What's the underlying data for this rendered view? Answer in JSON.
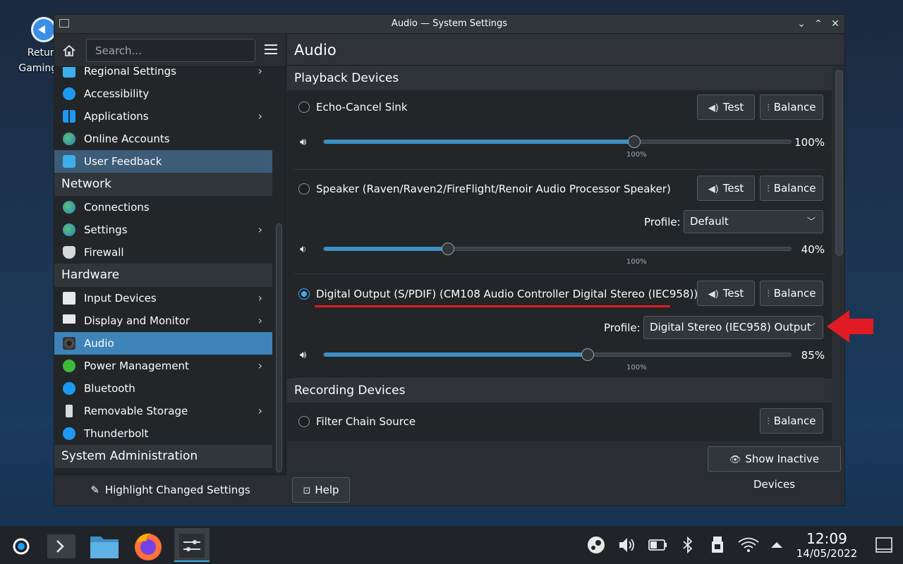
{
  "desktop": {
    "icon_label": "Return to Gaming Mode",
    "icon_label_visible": "Return\nGaming M"
  },
  "window": {
    "title": "Audio — System Settings"
  },
  "sidebar": {
    "search_placeholder": "Search...",
    "items": [
      {
        "label": "Regional Settings",
        "chevron": true,
        "color": "#3daee9"
      },
      {
        "label": "Accessibility",
        "chevron": false,
        "color": "#1d99f3"
      },
      {
        "label": "Applications",
        "chevron": true,
        "color": "#1d99f3"
      },
      {
        "label": "Online Accounts",
        "chevron": false,
        "color": "#27ae60"
      },
      {
        "label": "User Feedback",
        "chevron": false,
        "color": "#3daee9"
      }
    ],
    "network": {
      "category": "Network",
      "items": [
        {
          "label": "Connections",
          "chevron": false
        },
        {
          "label": "Settings",
          "chevron": true
        },
        {
          "label": "Firewall",
          "chevron": false
        }
      ]
    },
    "hardware": {
      "category": "Hardware",
      "items": [
        {
          "label": "Input Devices",
          "chevron": true
        },
        {
          "label": "Display and Monitor",
          "chevron": true
        },
        {
          "label": "Audio",
          "chevron": false
        },
        {
          "label": "Power Management",
          "chevron": true
        },
        {
          "label": "Bluetooth",
          "chevron": false
        },
        {
          "label": "Removable Storage",
          "chevron": true
        },
        {
          "label": "Thunderbolt",
          "chevron": false
        }
      ]
    },
    "system_admin": {
      "category": "System Administration"
    },
    "highlight_changed": "Highlight Changed Settings"
  },
  "main": {
    "title": "Audio",
    "playback_title": "Playback Devices",
    "recording_title": "Recording Devices",
    "test_label": "Test",
    "balance_label": "Balance",
    "profile_label": "Profile:",
    "tick_100": "100%",
    "devices": [
      {
        "name": "Echo-Cancel Sink",
        "volume": "100%",
        "volume_value": 100,
        "selected": false
      },
      {
        "name": "Speaker (Raven/Raven2/FireFlight/Renoir Audio Processor Speaker)",
        "profile": "Default",
        "volume": "40%",
        "volume_value": 40,
        "selected": false
      },
      {
        "name": "Digital Output (S/PDIF) (CM108 Audio Controller Digital Stereo (IEC958))",
        "profile": "Digital Stereo (IEC958) Output",
        "volume": "85%",
        "volume_value": 85,
        "selected": true
      }
    ],
    "recording": [
      {
        "name": "Filter Chain Source"
      }
    ],
    "show_inactive": "Show Inactive Devices",
    "help": "Help"
  },
  "taskbar": {
    "time": "12:09",
    "date": "14/05/2022"
  },
  "colors": {
    "accent": "#3daee9",
    "selected_row": "#3e84b8",
    "annotation_red": "#e01b24"
  }
}
